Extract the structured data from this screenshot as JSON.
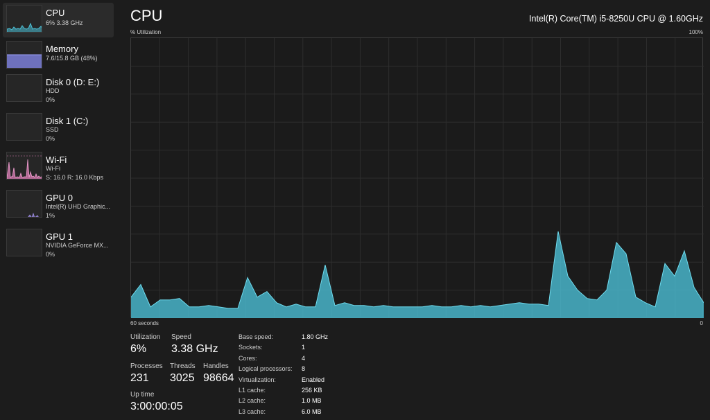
{
  "sidebar": {
    "items": [
      {
        "title": "CPU",
        "sub1": "6%  3.38 GHz",
        "sub2": "",
        "color": "#4cc2d8"
      },
      {
        "title": "Memory",
        "sub1": "7.6/15.8 GB (48%)",
        "sub2": "",
        "color": "#7b7fd8"
      },
      {
        "title": "Disk 0 (D: E:)",
        "sub1": "HDD",
        "sub2": "0%",
        "color": "#6fbf73"
      },
      {
        "title": "Disk 1 (C:)",
        "sub1": "SSD",
        "sub2": "0%",
        "color": "#6fbf73"
      },
      {
        "title": "Wi-Fi",
        "sub1": "Wi-Fi",
        "sub2": "S: 16.0  R: 16.0 Kbps",
        "color": "#e07fb8"
      },
      {
        "title": "GPU 0",
        "sub1": "Intel(R) UHD Graphic...",
        "sub2": "1%",
        "color": "#9b8be0"
      },
      {
        "title": "GPU 1",
        "sub1": "NVIDIA GeForce MX...",
        "sub2": "0%",
        "color": "#9b8be0"
      }
    ]
  },
  "main": {
    "title": "CPU",
    "cpu_name": "Intel(R) Core(TM) i5-8250U CPU @ 1.60GHz",
    "graph_label": "% Utilization",
    "graph_max": "100%",
    "graph_left_time": "60 seconds",
    "graph_right_time": "0",
    "accent": "#4cc2d8",
    "utilization_history": [
      7.5,
      12,
      4,
      6.5,
      6.5,
      7,
      4,
      4,
      4.5,
      4,
      3.5,
      3.5,
      14.5,
      7.5,
      9.5,
      5.5,
      4,
      5,
      4,
      4,
      19,
      4.5,
      5.5,
      4.5,
      4.5,
      4,
      4.5,
      4,
      4,
      4,
      4,
      4.5,
      4,
      4,
      4.5,
      4,
      4.5,
      4,
      4.5,
      5,
      5.5,
      5,
      5,
      4.5,
      31,
      15,
      10,
      7,
      6.5,
      10,
      27,
      23,
      7.5,
      5.5,
      4,
      19.5,
      15,
      24,
      11,
      5.5
    ]
  },
  "stats": {
    "utilization_label": "Utilization",
    "utilization_value": "6%",
    "speed_label": "Speed",
    "speed_value": "3.38 GHz",
    "processes_label": "Processes",
    "processes_value": "231",
    "threads_label": "Threads",
    "threads_value": "3025",
    "handles_label": "Handles",
    "handles_value": "98664",
    "uptime_label": "Up time",
    "uptime_value": "3:00:00:05"
  },
  "specs": [
    {
      "label": "Base speed:",
      "value": "1.80 GHz"
    },
    {
      "label": "Sockets:",
      "value": "1"
    },
    {
      "label": "Cores:",
      "value": "4"
    },
    {
      "label": "Logical processors:",
      "value": "8"
    },
    {
      "label": "Virtualization:",
      "value": "Enabled"
    },
    {
      "label": "L1 cache:",
      "value": "256 KB"
    },
    {
      "label": "L2 cache:",
      "value": "1.0 MB"
    },
    {
      "label": "L3 cache:",
      "value": "6.0 MB"
    }
  ]
}
